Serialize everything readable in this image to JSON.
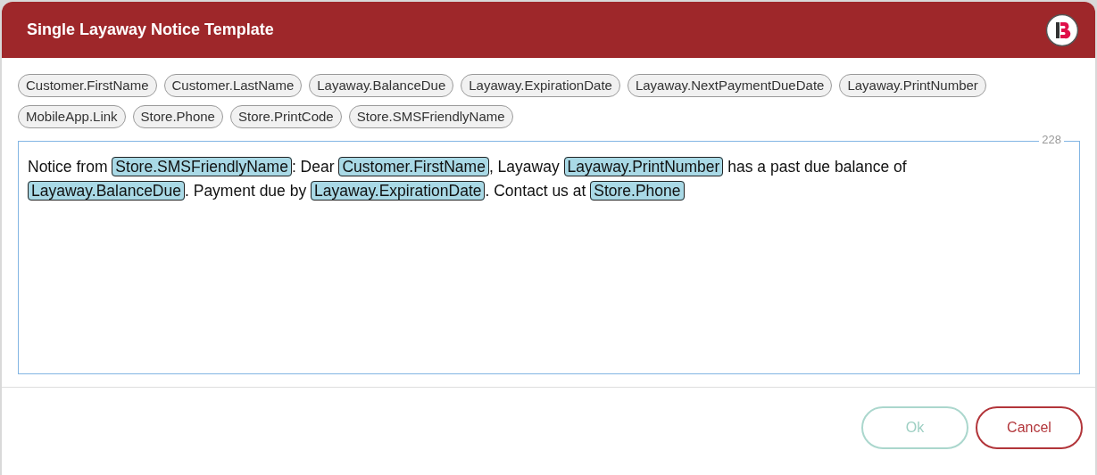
{
  "dialog": {
    "title": "Single Layaway Notice Template"
  },
  "fields": [
    "Customer.FirstName",
    "Customer.LastName",
    "Layaway.BalanceDue",
    "Layaway.ExpirationDate",
    "Layaway.NextPaymentDueDate",
    "Layaway.PrintNumber",
    "MobileApp.Link",
    "Store.Phone",
    "Store.PrintCode",
    "Store.SMSFriendlyName"
  ],
  "editor": {
    "counter": "228",
    "message": [
      {
        "kind": "text",
        "text": "Notice from"
      },
      {
        "kind": "token",
        "text": "Store.SMSFriendlyName"
      },
      {
        "kind": "text",
        "text": ": Dear"
      },
      {
        "kind": "token",
        "text": "Customer.FirstName"
      },
      {
        "kind": "text",
        "text": ", Layaway"
      },
      {
        "kind": "token",
        "text": "Layaway.PrintNumber"
      },
      {
        "kind": "text",
        "text": "has a past due balance of"
      },
      {
        "kind": "token",
        "text": "Layaway.BalanceDue"
      },
      {
        "kind": "text",
        "text": ". Payment due by"
      },
      {
        "kind": "token",
        "text": "Layaway.ExpirationDate"
      },
      {
        "kind": "text",
        "text": ". Contact us at"
      },
      {
        "kind": "token",
        "text": "Store.Phone"
      }
    ]
  },
  "buttons": [
    {
      "label": "Ok",
      "kind": "ok",
      "disabled": true
    },
    {
      "label": "Cancel",
      "kind": "cancel",
      "disabled": false
    }
  ]
}
